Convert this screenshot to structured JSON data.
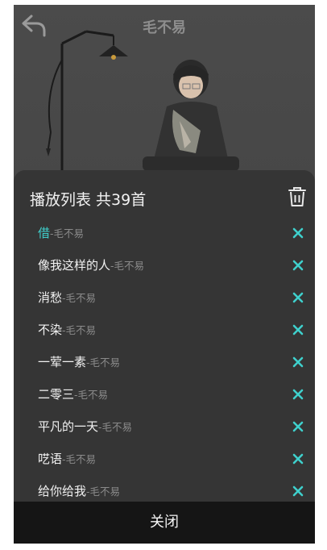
{
  "header": {
    "title": "毛不易"
  },
  "playlist": {
    "title": "播放列表 共39首",
    "accent_color": "#3fd0cc",
    "items": [
      {
        "song": "借",
        "artist": "-毛不易",
        "active": true
      },
      {
        "song": "像我这样的人",
        "artist": "-毛不易",
        "active": false
      },
      {
        "song": "消愁",
        "artist": "-毛不易",
        "active": false
      },
      {
        "song": "不染",
        "artist": "-毛不易",
        "active": false
      },
      {
        "song": "一荤一素",
        "artist": "-毛不易",
        "active": false
      },
      {
        "song": "二零三",
        "artist": "-毛不易",
        "active": false
      },
      {
        "song": "平凡的一天",
        "artist": "-毛不易",
        "active": false
      },
      {
        "song": "呓语",
        "artist": "-毛不易",
        "active": false
      },
      {
        "song": "给你给我",
        "artist": "-毛不易",
        "active": false
      }
    ]
  },
  "footer": {
    "close_label": "关闭"
  },
  "icons": {
    "back": "back-arrow-icon",
    "trash": "trash-icon",
    "remove": "close-x-icon"
  }
}
